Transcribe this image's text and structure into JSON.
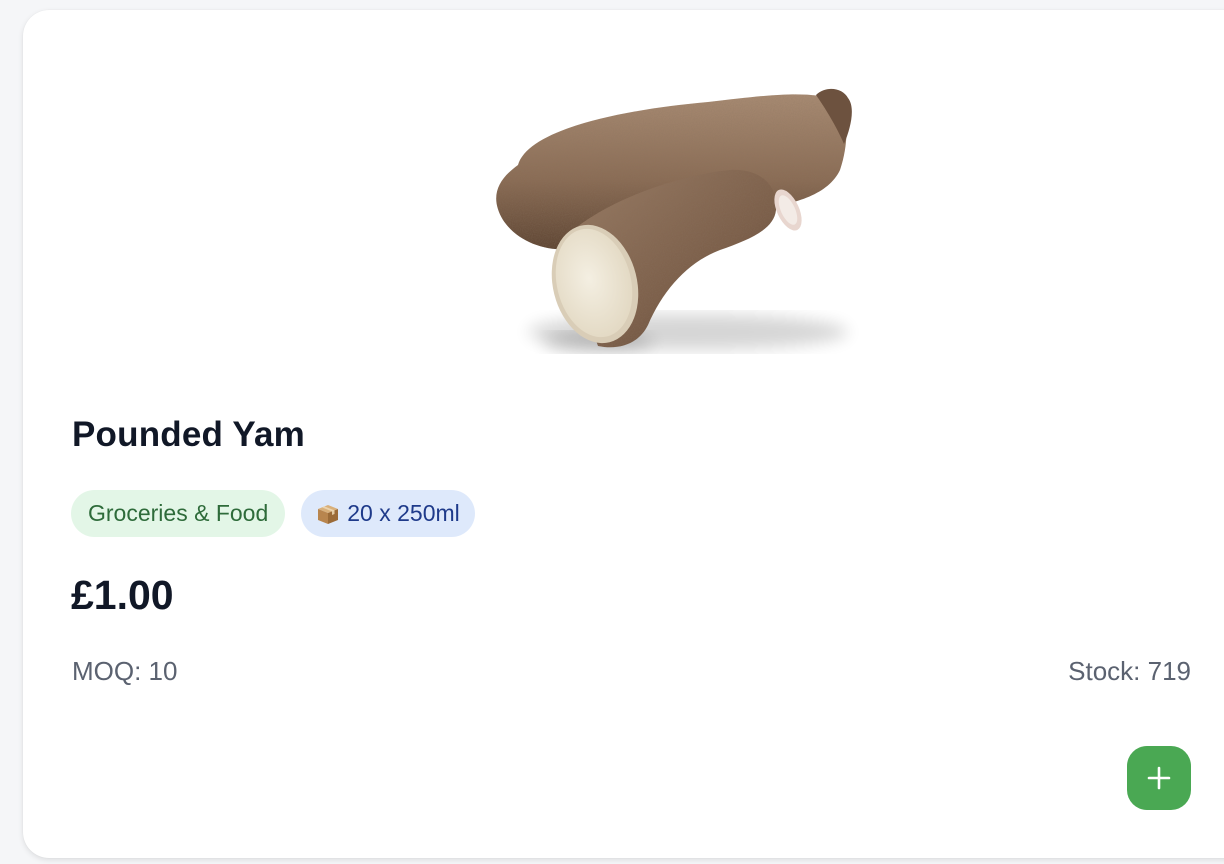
{
  "product": {
    "name": "Pounded Yam",
    "category": "Groceries & Food",
    "pack_size": "20 x 250ml",
    "pack_icon": "package-box-icon",
    "price": "£1.00",
    "moq": "MOQ: 10",
    "stock": "Stock: 719",
    "image_icon": "yam-image"
  },
  "actions": {
    "add_icon": "plus-icon"
  },
  "colors": {
    "accent_green": "#4aa853",
    "category_bg": "#e3f6e7",
    "category_text": "#2e6b3a",
    "pack_bg": "#dee9fb",
    "pack_text": "#1e3a8a",
    "title_text": "#111827",
    "muted_text": "#5b6270"
  }
}
